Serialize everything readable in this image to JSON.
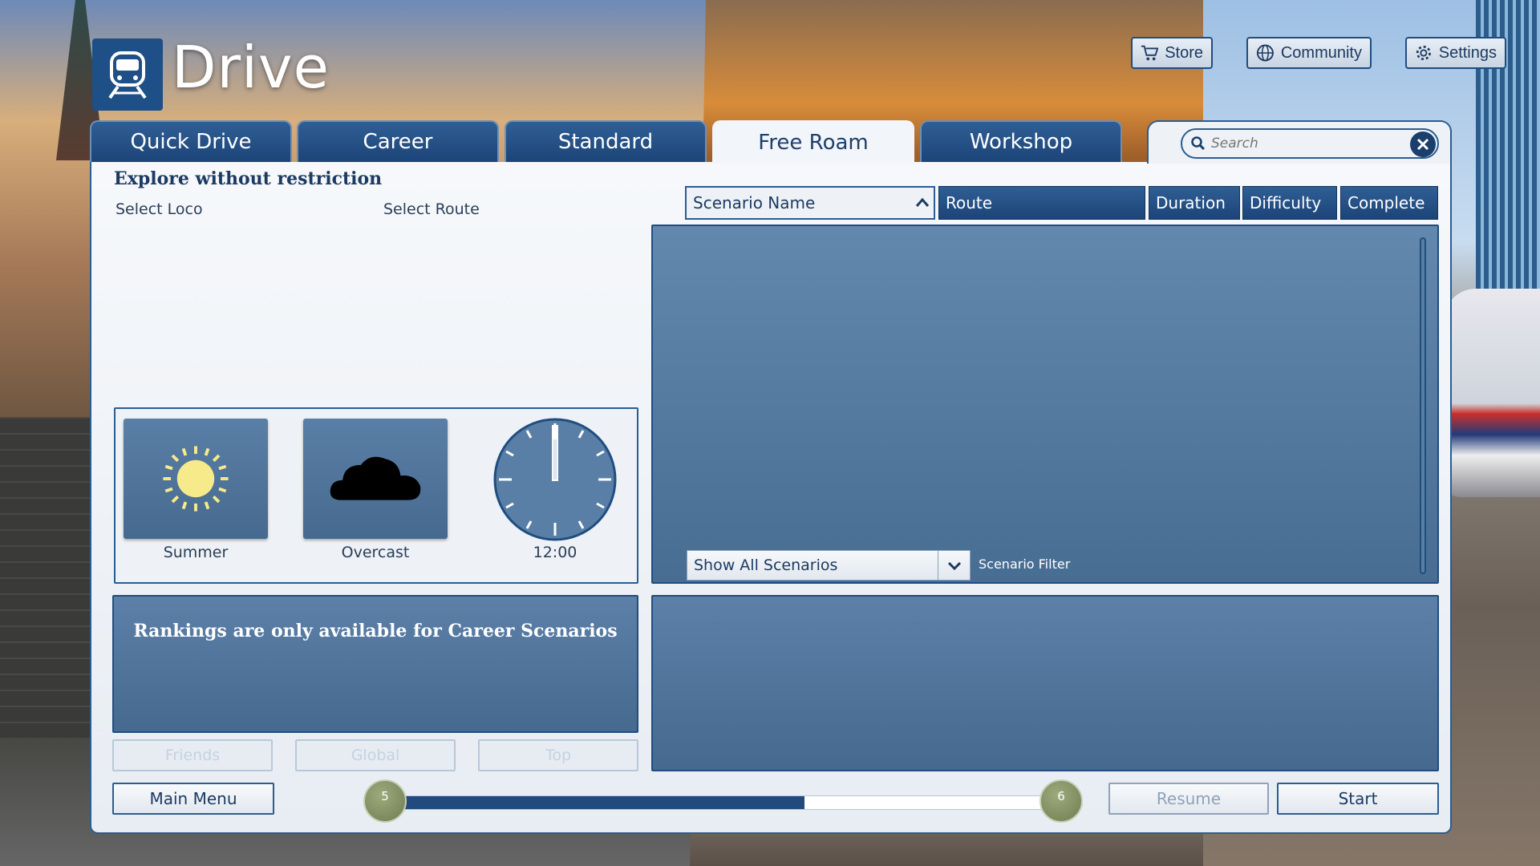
{
  "app": {
    "title": "Drive"
  },
  "topbar": {
    "store": "Store",
    "community": "Community",
    "settings": "Settings"
  },
  "tabs": [
    {
      "label": "Quick Drive",
      "active": false
    },
    {
      "label": "Career",
      "active": false
    },
    {
      "label": "Standard",
      "active": false
    },
    {
      "label": "Free Roam",
      "active": true
    },
    {
      "label": "Workshop",
      "active": false
    }
  ],
  "search": {
    "placeholder": "Search",
    "value": ""
  },
  "left": {
    "subtitle": "Explore without restriction",
    "select_loco": "Select Loco",
    "select_route": "Select Route",
    "season": "Summer",
    "weather": "Overcast",
    "time": "12:00",
    "rankings_message": "Rankings are only available for Career Scenarios",
    "ranking_buttons": [
      "Friends",
      "Global",
      "Top"
    ]
  },
  "table": {
    "columns": [
      "Scenario Name",
      "Route",
      "Duration",
      "Difficulty",
      "Complete"
    ],
    "sorted_column": "Scenario Name",
    "sort_direction": "ascending",
    "rows": []
  },
  "filter": {
    "value": "Show All Scenarios",
    "label": "Scenario Filter"
  },
  "bottom": {
    "main_menu": "Main Menu",
    "resume": "Resume",
    "start": "Start",
    "progress": {
      "min_label": "5",
      "max_label": "6",
      "fraction": 0.615
    }
  },
  "colors": {
    "accent": "#1e4f86",
    "tab_active_bg": "#f2f5f9",
    "panel_blue": "#486d93",
    "knob": "#707d52"
  }
}
